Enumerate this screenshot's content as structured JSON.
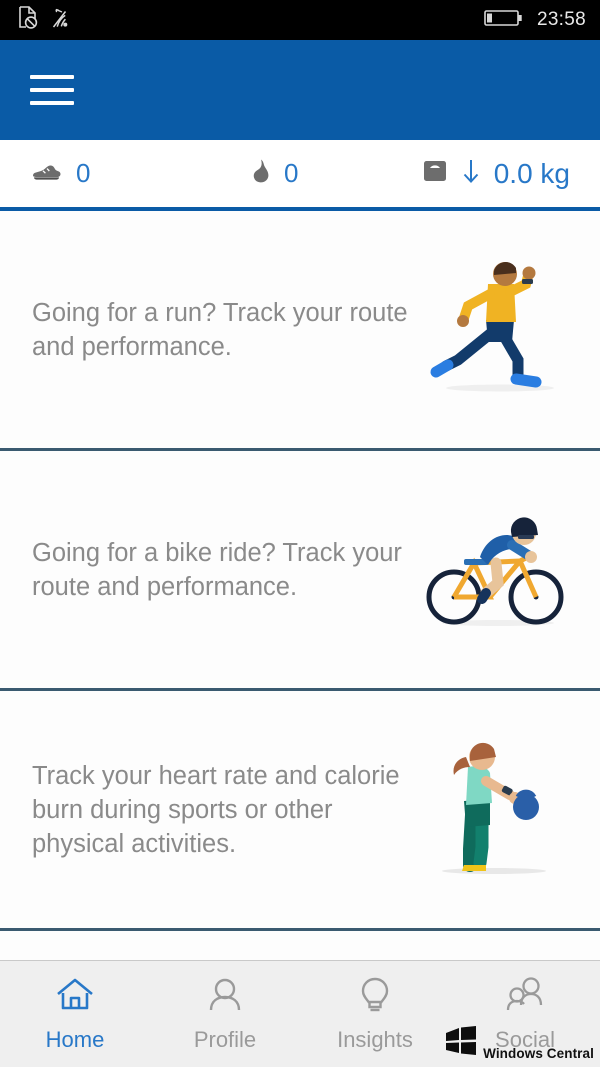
{
  "statusbar": {
    "icons": [
      "no-sim-icon",
      "wifi-icon",
      "battery-icon"
    ],
    "time": "23:58"
  },
  "appbar": {
    "menu_label": "menu"
  },
  "stats": {
    "steps": {
      "icon": "shoe-icon",
      "value": "0"
    },
    "calories": {
      "icon": "flame-icon",
      "value": "0"
    },
    "weight": {
      "icon": "scale-icon",
      "trend_icon": "arrow-down-icon",
      "value": "0.0 kg"
    }
  },
  "cards": [
    {
      "text": "Going for a run? Track your route and performance.",
      "art": "runner-illustration"
    },
    {
      "text": "Going for a bike ride? Track your route and performance.",
      "art": "cyclist-illustration"
    },
    {
      "text": "Track your heart rate and calorie burn during sports or other physical activities.",
      "art": "kettlebell-illustration"
    }
  ],
  "nav": [
    {
      "label": "Home",
      "icon": "home-icon",
      "active": true
    },
    {
      "label": "Profile",
      "icon": "person-icon",
      "active": false
    },
    {
      "label": "Insights",
      "icon": "lightbulb-icon",
      "active": false
    },
    {
      "label": "Social",
      "icon": "people-icon",
      "active": false
    }
  ],
  "watermark": {
    "text": "Windows Central",
    "logo": "windows-logo"
  },
  "colors": {
    "accent_blue": "#0a5ba6",
    "text_blue": "#2878c8",
    "divider": "#3a5a70",
    "muted_text": "#8a8a8a",
    "navbar_bg": "#efefef"
  }
}
